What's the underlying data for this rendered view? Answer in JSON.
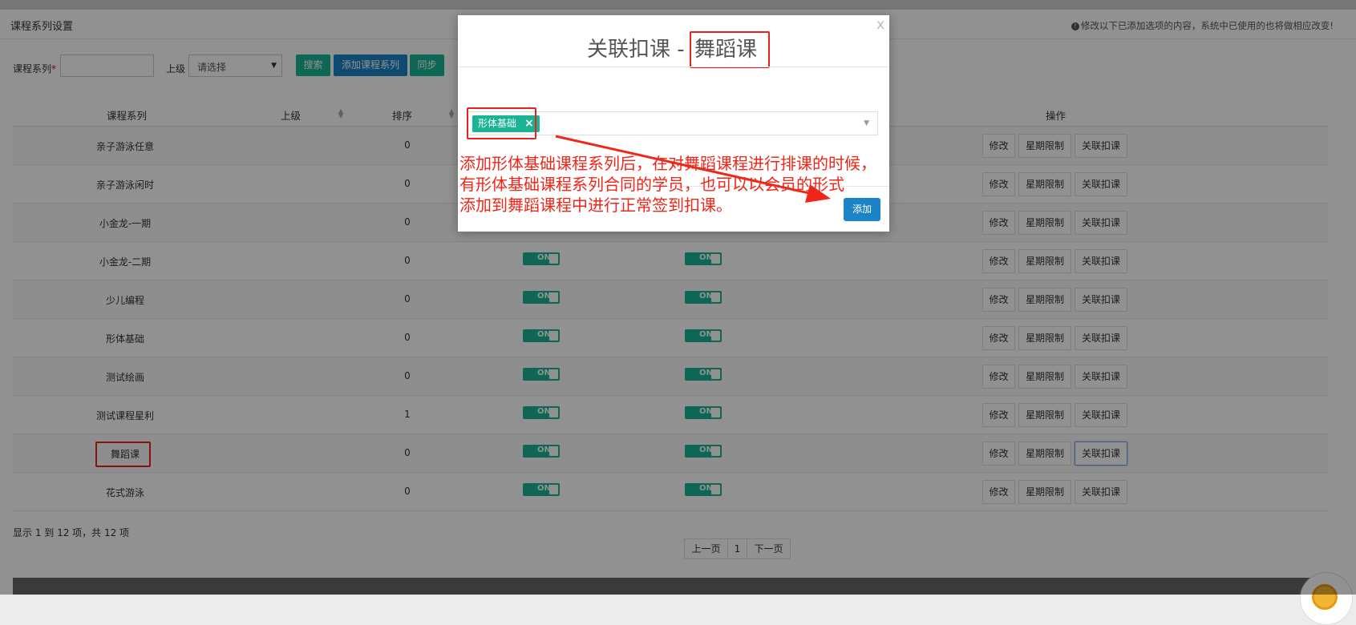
{
  "panel": {
    "title": "课程系列设置",
    "note": "修改以下已添加选项的内容，系统中已使用的也将做相应改变!"
  },
  "form": {
    "series_label": "课程系列",
    "required_mark": "*",
    "series_value": "",
    "parent_label": "上级",
    "parent_select_value": "请选择",
    "search_btn": "搜索",
    "add_series_btn": "添加课程系列",
    "sync_btn": "同步"
  },
  "table": {
    "columns": [
      "课程系列",
      "上级",
      "排序",
      "操作"
    ],
    "rows": [
      {
        "name": "亲子游泳任意",
        "parent": "",
        "order": "0",
        "toggles": false
      },
      {
        "name": "亲子游泳闲时",
        "parent": "",
        "order": "0",
        "toggles": false
      },
      {
        "name": "小金龙-一期",
        "parent": "",
        "order": "0",
        "toggles": false
      },
      {
        "name": "小金龙-二期",
        "parent": "",
        "order": "0",
        "toggles": true
      },
      {
        "name": "少儿编程",
        "parent": "",
        "order": "0",
        "toggles": true
      },
      {
        "name": "形体基础",
        "parent": "",
        "order": "0",
        "toggles": true
      },
      {
        "name": "测试绘画",
        "parent": "",
        "order": "0",
        "toggles": true
      },
      {
        "name": "测试课程星利",
        "parent": "",
        "order": "1",
        "toggles": true
      },
      {
        "name": "舞蹈课",
        "parent": "",
        "order": "0",
        "toggles": true
      },
      {
        "name": "花式游泳",
        "parent": "",
        "order": "0",
        "toggles": true
      }
    ],
    "toggle_text": "ON",
    "op_edit": "修改",
    "op_week": "星期限制",
    "op_link": "关联扣课"
  },
  "footer": {
    "info": "显示 1 到 12 项，共 12 项",
    "prev": "上一页",
    "page": "1",
    "next": "下一页"
  },
  "modal": {
    "close": "x",
    "title_prefix": "关联扣课 - ",
    "title_course": "舞蹈课",
    "chip_label": "形体基础",
    "chip_remove": "×",
    "add_btn": "添加"
  },
  "annotation": {
    "line1": "添加形体基础课程系列后，在对舞蹈课程进行排课的时候，",
    "line2": "有形体基础课程系列合同的学员，也可以以会员的形式",
    "line3": "添加到舞蹈课程中进行正常签到扣课。"
  },
  "colors": {
    "teal": "#1ab394",
    "blue": "#1c84c6",
    "annotation_red": "#f02618"
  }
}
